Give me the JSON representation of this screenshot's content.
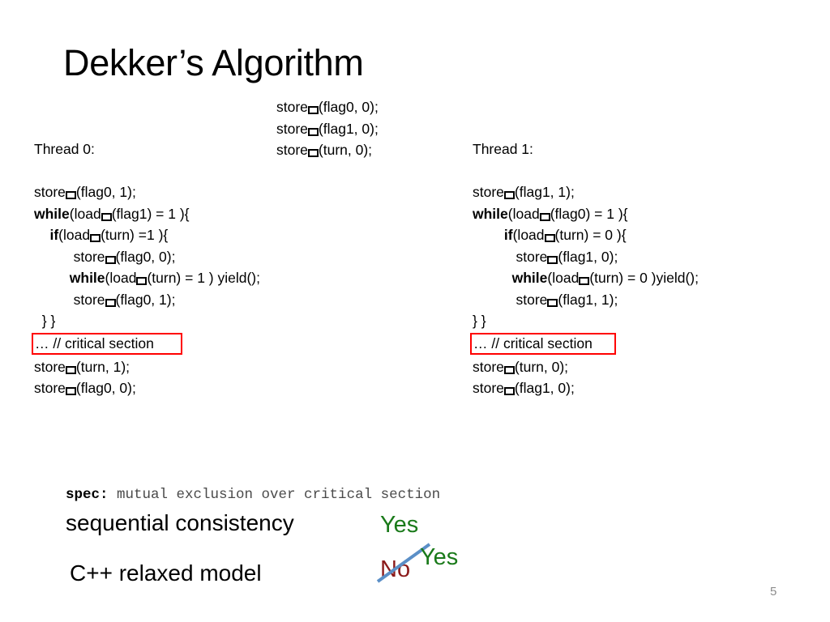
{
  "slide": {
    "title": "Dekker’s Algorithm",
    "page_number": "5"
  },
  "init_block": {
    "lines": [
      {
        "pre": "store",
        "box": true,
        "post": "(flag0, 0);"
      },
      {
        "pre": "store",
        "box": true,
        "post": "(flag1, 0);"
      },
      {
        "pre": "store",
        "box": true,
        "post": "(turn, 0);"
      }
    ]
  },
  "threads": [
    {
      "label": "Thread 0:",
      "critical_section_text": "… // critical section",
      "lines": [
        {
          "indent": "",
          "kw": "",
          "pre": "store",
          "box": true,
          "post": "(flag0, 1);"
        },
        {
          "indent": "",
          "kw": "while",
          "pre": "(load",
          "box": true,
          "post": "(flag1) = 1 ){"
        },
        {
          "indent": "    ",
          "kw": "if",
          "pre": "(load",
          "box": true,
          "post": "(turn) =1 ){"
        },
        {
          "indent": "          ",
          "kw": "",
          "pre": "store",
          "box": true,
          "post": "(flag0, 0);"
        },
        {
          "indent": "         ",
          "kw": "while",
          "pre": "(load",
          "box": true,
          "post": "(turn) = 1 ) yield();"
        },
        {
          "indent": "          ",
          "kw": "",
          "pre": "store",
          "box": true,
          "post": "(flag0, 1);"
        },
        {
          "indent": "  ",
          "kw": "",
          "pre": "} }",
          "box": false,
          "post": ""
        },
        {
          "indent": "",
          "kw": "",
          "pre": "",
          "box": false,
          "post": "",
          "critical": true
        },
        {
          "indent": "",
          "kw": "",
          "pre": "store",
          "box": true,
          "post": "(turn, 1);"
        },
        {
          "indent": "",
          "kw": "",
          "pre": "store",
          "box": true,
          "post": "(flag0, 0);"
        }
      ]
    },
    {
      "label": "Thread 1:",
      "critical_section_text": "… // critical section",
      "lines": [
        {
          "indent": "",
          "kw": "",
          "pre": "store",
          "box": true,
          "post": "(flag1, 1);"
        },
        {
          "indent": "",
          "kw": "while",
          "pre": "(load",
          "box": true,
          "post": "(flag0) = 1 ){"
        },
        {
          "indent": "        ",
          "kw": "if",
          "pre": "(load",
          "box": true,
          "post": "(turn) = 0 ){"
        },
        {
          "indent": "           ",
          "kw": "",
          "pre": "store",
          "box": true,
          "post": "(flag1, 0);"
        },
        {
          "indent": "          ",
          "kw": "while",
          "pre": "(load",
          "box": true,
          "post": "(turn) = 0 )yield();"
        },
        {
          "indent": "           ",
          "kw": "",
          "pre": "store",
          "box": true,
          "post": "(flag1, 1);"
        },
        {
          "indent": "",
          "kw": "",
          "pre": "} }",
          "box": false,
          "post": ""
        },
        {
          "indent": "",
          "kw": "",
          "pre": "",
          "box": false,
          "post": "",
          "critical": true
        },
        {
          "indent": "",
          "kw": "",
          "pre": "store",
          "box": true,
          "post": "(turn, 0);"
        },
        {
          "indent": "",
          "kw": "",
          "pre": "store",
          "box": true,
          "post": "(flag1, 0);"
        }
      ]
    }
  ],
  "spec": {
    "key": "spec:",
    "text": " mutual exclusion over critical section",
    "rows": [
      {
        "model": "sequential consistency",
        "verdict": "Yes"
      },
      {
        "model": "C++ relaxed model",
        "verdict_struck": "No",
        "verdict_corrected": "Yes"
      }
    ]
  },
  "colors": {
    "critical_box_border": "#ff0000",
    "verdict_yes": "#1a7a1a",
    "verdict_no": "#8b1a1a",
    "strikethrough": "#5b8fc7",
    "page_number": "#8c8c8c"
  }
}
